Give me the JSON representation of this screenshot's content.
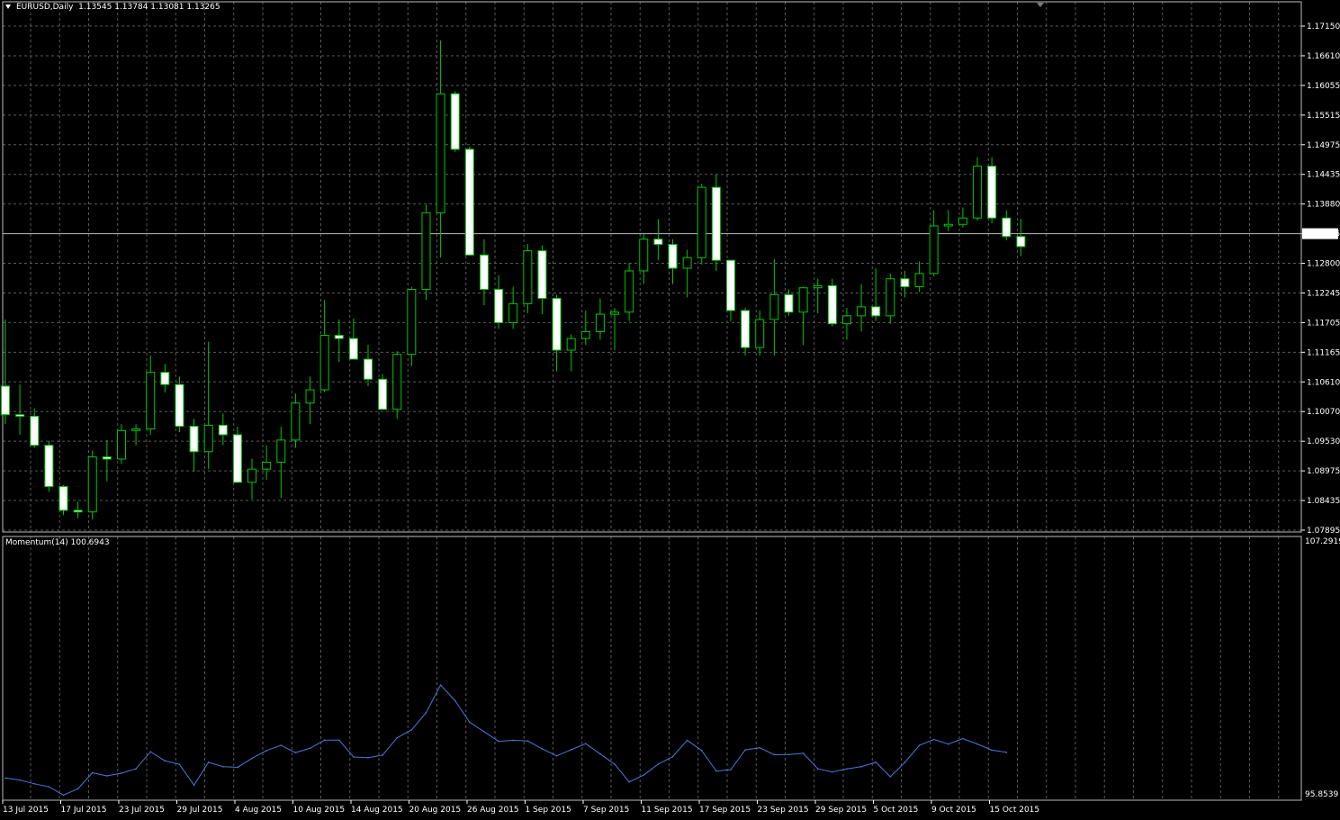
{
  "symbol_header": {
    "symbol": "EURUSD,Daily",
    "ohlc": "1.13545 1.13784 1.13081 1.13265"
  },
  "indicator_header": {
    "label": "Momentum(14) 100.6943"
  },
  "colors": {
    "background": "#000000",
    "grid": "#5a5a5a",
    "bull_candle": "#000000",
    "bear_candle": "#ffffff",
    "wick": "#00c800",
    "momentum_line": "#4a78d8",
    "text": "#ffffff"
  },
  "chart_data": [
    {
      "type": "candlestick",
      "symbol": "EURUSD",
      "timeframe": "Daily",
      "ylim": [
        1.07895,
        1.1743
      ],
      "y_ticks": [
        "1.17150",
        "1.16610",
        "1.16055",
        "1.15515",
        "1.14975",
        "1.14435",
        "1.13880",
        "1.13265",
        "1.12800",
        "1.12245",
        "1.11705",
        "1.11165",
        "1.10610",
        "1.10070",
        "1.09530",
        "1.08975",
        "1.08435",
        "1.07895"
      ],
      "current_price": "1.13265",
      "grid": true,
      "ohlc": [
        [
          1.1062,
          1.1188,
          1.099,
          1.1008
        ],
        [
          1.1008,
          1.1065,
          1.097,
          1.1005
        ],
        [
          1.1005,
          1.102,
          1.0945,
          1.095
        ],
        [
          1.095,
          1.0958,
          1.0862,
          1.0872
        ],
        [
          1.0872,
          1.0875,
          1.0818,
          1.0827
        ],
        [
          1.0827,
          1.0843,
          1.0812,
          1.0824
        ],
        [
          1.0824,
          1.094,
          1.081,
          1.0928
        ],
        [
          1.0928,
          1.096,
          1.0882,
          1.0924
        ],
        [
          1.0924,
          1.099,
          1.0915,
          1.0978
        ],
        [
          1.0978,
          1.099,
          1.095,
          1.0981
        ],
        [
          1.0981,
          1.112,
          1.097,
          1.1088
        ],
        [
          1.1088,
          1.1104,
          1.105,
          1.1065
        ],
        [
          1.1065,
          1.108,
          1.0975,
          1.0986
        ],
        [
          1.0986,
          1.1,
          1.09,
          1.0938
        ],
        [
          1.0938,
          1.1146,
          1.0905,
          1.0988
        ],
        [
          1.0988,
          1.101,
          1.095,
          1.097
        ],
        [
          1.097,
          1.0985,
          1.088,
          1.088
        ],
        [
          1.088,
          1.0925,
          1.0848,
          1.0905
        ],
        [
          1.0905,
          1.095,
          1.0885,
          1.0918
        ],
        [
          1.0918,
          1.0985,
          1.085,
          1.096
        ],
        [
          1.096,
          1.1048,
          1.0945,
          1.103
        ],
        [
          1.103,
          1.108,
          1.099,
          1.1055
        ],
        [
          1.1055,
          1.1225,
          1.105,
          1.1158
        ],
        [
          1.1158,
          1.1188,
          1.1108,
          1.1152
        ],
        [
          1.1152,
          1.119,
          1.1128,
          1.1113
        ],
        [
          1.1113,
          1.114,
          1.1062,
          1.1075
        ],
        [
          1.1075,
          1.1085,
          1.1022,
          1.1018
        ],
        [
          1.1018,
          1.1128,
          1.1,
          1.1122
        ],
        [
          1.1122,
          1.125,
          1.11,
          1.1245
        ],
        [
          1.1245,
          1.1405,
          1.1225,
          1.139
        ],
        [
          1.139,
          1.1716,
          1.1305,
          1.1615
        ],
        [
          1.1615,
          1.162,
          1.1505,
          1.151
        ],
        [
          1.151,
          1.1515,
          1.131,
          1.131
        ],
        [
          1.131,
          1.134,
          1.1215,
          1.1245
        ],
        [
          1.1245,
          1.1272,
          1.117,
          1.1182
        ],
        [
          1.1182,
          1.125,
          1.117,
          1.1218
        ],
        [
          1.1218,
          1.1331,
          1.12,
          1.1318
        ],
        [
          1.1318,
          1.1328,
          1.1198,
          1.1228
        ],
        [
          1.1228,
          1.1235,
          1.109,
          1.113
        ],
        [
          1.113,
          1.116,
          1.109,
          1.1152
        ],
        [
          1.1152,
          1.1205,
          1.114,
          1.1165
        ],
        [
          1.1165,
          1.1228,
          1.115,
          1.1198
        ],
        [
          1.1198,
          1.121,
          1.113,
          1.1202
        ],
        [
          1.1202,
          1.1295,
          1.1185,
          1.128
        ],
        [
          1.128,
          1.135,
          1.1255,
          1.134
        ],
        [
          1.134,
          1.1378,
          1.13,
          1.133
        ],
        [
          1.133,
          1.134,
          1.1255,
          1.1285
        ],
        [
          1.1285,
          1.132,
          1.123,
          1.1305
        ],
        [
          1.1305,
          1.1445,
          1.1292,
          1.1438
        ],
        [
          1.1438,
          1.1462,
          1.128,
          1.13
        ],
        [
          1.13,
          1.13,
          1.1185,
          1.1205
        ],
        [
          1.1205,
          1.121,
          1.112,
          1.1135
        ],
        [
          1.1135,
          1.1205,
          1.112,
          1.1188
        ],
        [
          1.1188,
          1.1302,
          1.112,
          1.1235
        ],
        [
          1.1235,
          1.1245,
          1.1195,
          1.1202
        ],
        [
          1.1202,
          1.125,
          1.114,
          1.1248
        ],
        [
          1.1248,
          1.1265,
          1.12,
          1.1252
        ],
        [
          1.1252,
          1.1265,
          1.1175,
          1.118
        ],
        [
          1.118,
          1.121,
          1.115,
          1.1195
        ],
        [
          1.1195,
          1.1255,
          1.1165,
          1.1212
        ],
        [
          1.1212,
          1.1285,
          1.1185,
          1.1195
        ],
        [
          1.1195,
          1.1275,
          1.118,
          1.1265
        ],
        [
          1.1265,
          1.128,
          1.123,
          1.125
        ],
        [
          1.125,
          1.1298,
          1.124,
          1.1275
        ],
        [
          1.1275,
          1.1395,
          1.127,
          1.1365
        ],
        [
          1.1365,
          1.1395,
          1.1355,
          1.1368
        ],
        [
          1.1368,
          1.14,
          1.1362,
          1.138
        ],
        [
          1.138,
          1.1495,
          1.1375,
          1.1478
        ],
        [
          1.1478,
          1.1495,
          1.137,
          1.138
        ],
        [
          1.138,
          1.1395,
          1.1338,
          1.1345
        ],
        [
          1.1345,
          1.1378,
          1.1308,
          1.1326
        ]
      ]
    },
    {
      "type": "line",
      "indicator": "Momentum(14)",
      "current_value": "100.6943",
      "ylim": [
        95.8539,
        107.2919
      ],
      "y_ticks": [
        "107.2919",
        "95.8539"
      ],
      "series": [
        {
          "name": "Momentum(14)",
          "values": [
            96.4,
            96.3,
            96.12,
            95.98,
            95.58,
            95.88,
            96.65,
            96.5,
            96.63,
            96.84,
            97.65,
            97.22,
            97.05,
            96.06,
            97.15,
            96.94,
            96.91,
            97.34,
            97.71,
            97.96,
            97.61,
            97.82,
            98.21,
            98.21,
            97.4,
            97.37,
            97.49,
            98.32,
            98.7,
            99.52,
            100.84,
            100.09,
            99.06,
            98.61,
            98.15,
            98.2,
            98.17,
            97.79,
            97.46,
            97.75,
            98.04,
            97.55,
            97.06,
            96.21,
            96.54,
            97.06,
            97.42,
            98.2,
            97.71,
            96.73,
            96.8,
            97.74,
            97.84,
            97.51,
            97.52,
            97.58,
            96.84,
            96.69,
            96.83,
            96.94,
            97.15,
            96.46,
            97.14,
            97.96,
            98.24,
            98.02,
            98.28,
            98.02,
            97.73,
            97.63
          ]
        }
      ]
    }
  ],
  "x_axis": {
    "labels": [
      "13 Jul 2015",
      "17 Jul 2015",
      "23 Jul 2015",
      "29 Jul 2015",
      "4 Aug 2015",
      "10 Aug 2015",
      "14 Aug 2015",
      "20 Aug 2015",
      "26 Aug 2015",
      "1 Sep 2015",
      "7 Sep 2015",
      "11 Sep 2015",
      "17 Sep 2015",
      "23 Sep 2015",
      "29 Sep 2015",
      "5 Oct 2015",
      "9 Oct 2015",
      "15 Oct 2015"
    ]
  }
}
